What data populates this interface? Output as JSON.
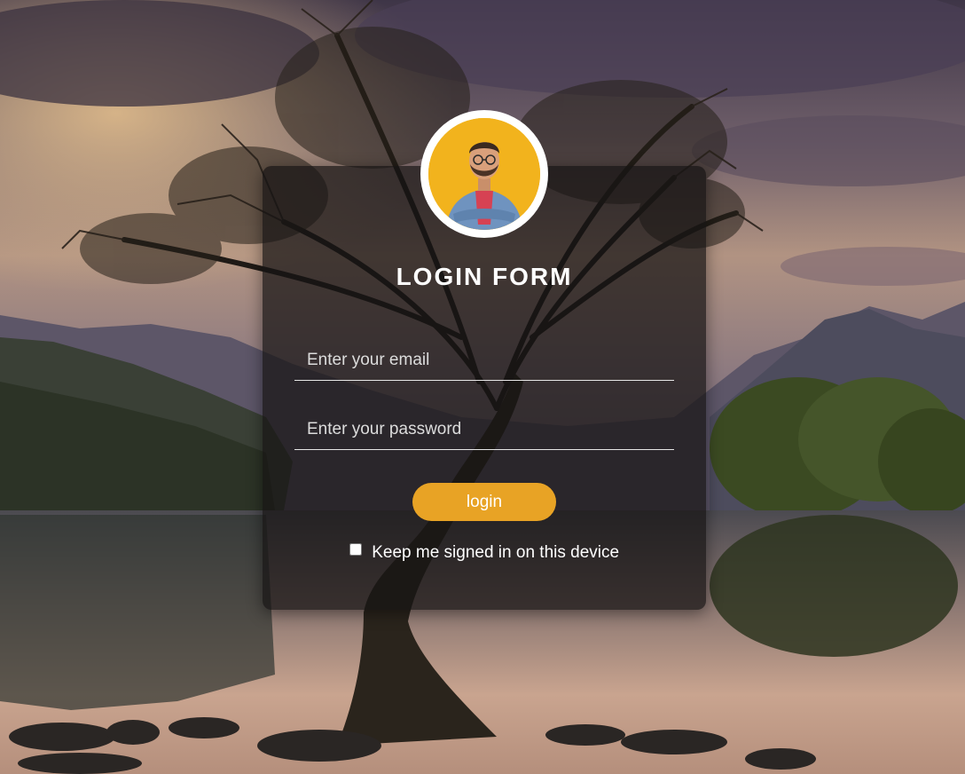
{
  "form": {
    "title": "LOGIN FORM",
    "email_placeholder": "Enter your email",
    "password_placeholder": "Enter your password",
    "login_label": "login",
    "remember_label": "Keep me signed in on this device",
    "remember_checked": false
  },
  "icons": {
    "avatar": "user-avatar-photo",
    "background": "lake-tree-landscape-photo"
  },
  "colors": {
    "accent": "#e8a325",
    "card_bg": "rgba(22,20,20,0.72)",
    "avatar_bg": "#f2b31d",
    "text": "#ffffff"
  }
}
